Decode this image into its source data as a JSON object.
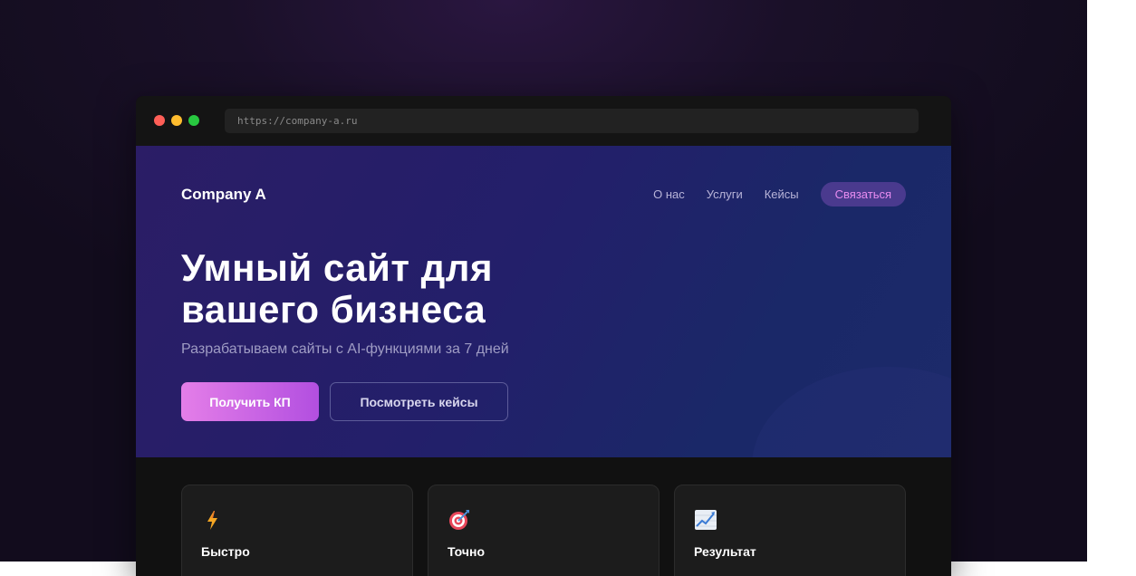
{
  "browser": {
    "url": "https://company-a.ru"
  },
  "header": {
    "logo": "Company A",
    "nav": [
      "О нас",
      "Услуги",
      "Кейсы"
    ],
    "contact_label": "Связаться"
  },
  "hero": {
    "headline_line1": "Умный сайт для",
    "headline_line2": "вашего бизнеса",
    "subtitle": "Разрабатываем сайты с AI-функциями за 7 дней",
    "primary_cta": "Получить КП",
    "secondary_cta": "Посмотреть кейсы"
  },
  "features": [
    {
      "icon": "lightning-icon",
      "title": "Быстро"
    },
    {
      "icon": "target-icon",
      "title": "Точно"
    },
    {
      "icon": "chart-up-icon",
      "title": "Результат"
    }
  ],
  "colors": {
    "accent_pink": "#e47ee8",
    "accent_purple": "#b24fe0",
    "hero_bg": "#2b1d66"
  }
}
